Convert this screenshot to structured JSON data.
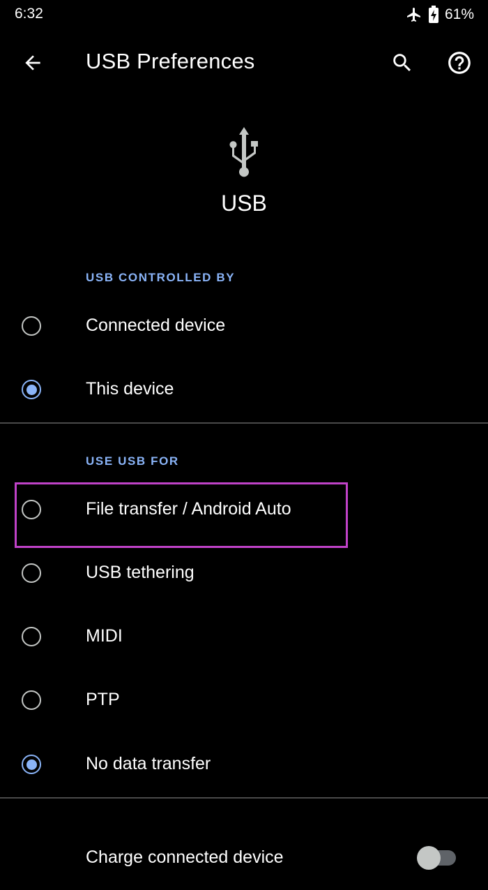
{
  "status_bar": {
    "time": "6:32",
    "battery_percent": "61%",
    "icons": [
      "airplane-icon",
      "battery-charging-icon"
    ]
  },
  "app_bar": {
    "title": "USB Preferences",
    "icons": [
      "back-arrow-icon",
      "search-icon",
      "help-icon"
    ]
  },
  "header": {
    "icon": "usb-icon",
    "label": "USB"
  },
  "usb_controlled_by": {
    "header": "USB CONTROLLED BY",
    "options": [
      {
        "label": "Connected device",
        "selected": false
      },
      {
        "label": "This device",
        "selected": true
      }
    ]
  },
  "use_usb_for": {
    "header": "USE USB FOR",
    "options": [
      {
        "label": "File transfer / Android Auto",
        "selected": false,
        "highlighted": true
      },
      {
        "label": "USB tethering",
        "selected": false
      },
      {
        "label": "MIDI",
        "selected": false
      },
      {
        "label": "PTP",
        "selected": false
      },
      {
        "label": "No data transfer",
        "selected": true
      }
    ]
  },
  "charge_toggle": {
    "label": "Charge connected device",
    "enabled": false
  },
  "colors": {
    "background": "#000000",
    "accent": "#8ab4f8",
    "highlight": "#c042c8",
    "divider": "#4a4a4a",
    "radio_unselected": "#c4c7c5"
  }
}
